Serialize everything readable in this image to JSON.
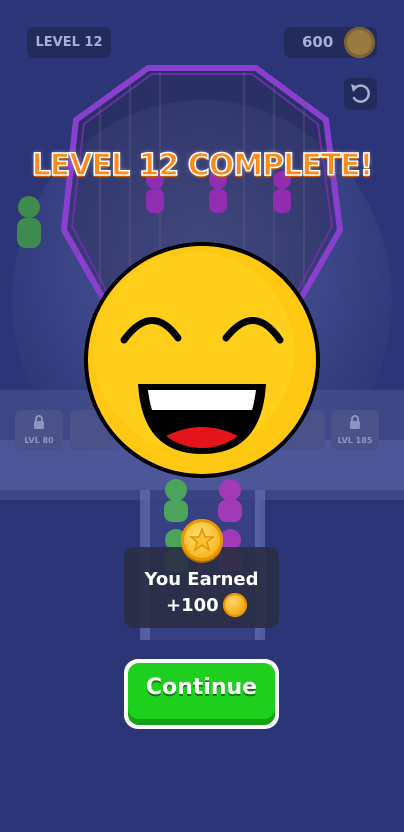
{
  "hud": {
    "level_label": "LEVEL 12",
    "coins": "600"
  },
  "locked_areas": [
    {
      "label": "LVL 80"
    },
    {
      "label": "LVL 185"
    }
  ],
  "modal": {
    "title": "LEVEL 12 COMPLETE!",
    "face_icon": "laughing-emoji",
    "earned_label": "You Earned",
    "earned_amount": "+100",
    "coin_icon": "gold-coin",
    "continue_label": "Continue"
  },
  "colors": {
    "background": "#2c3577",
    "title": "#ff8a1a",
    "emoji": "#ffc812",
    "continue_button": "#1ecf1e",
    "cage": "#8b3fd1"
  }
}
